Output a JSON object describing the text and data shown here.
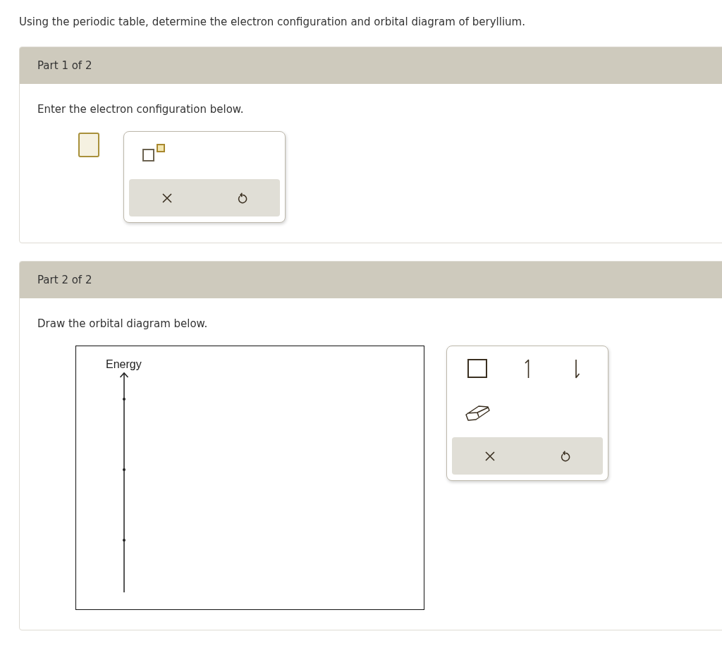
{
  "question": "Using the periodic table, determine the electron configuration and orbital diagram of beryllium.",
  "parts": [
    {
      "kind": "configuration",
      "title": "Part 1 of 2",
      "prompt": "Enter the electron configuration below."
    },
    {
      "kind": "orbital",
      "title": "Part 2 of 2",
      "prompt": "Draw the orbital diagram below.",
      "diagram": {
        "axis_label": "Energy"
      }
    }
  ]
}
